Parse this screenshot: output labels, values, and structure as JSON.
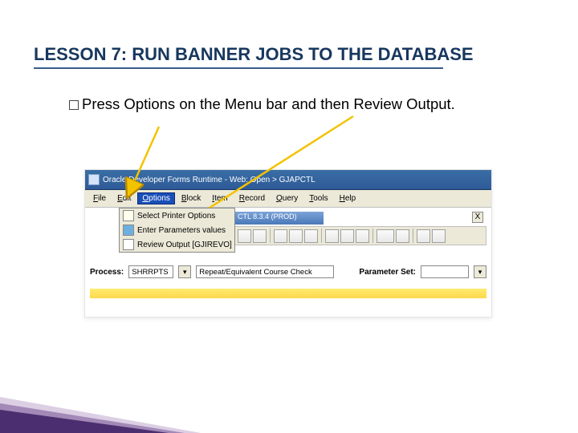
{
  "title": "LESSON 7: RUN BANNER JOBS TO THE DATABASE",
  "body": {
    "line": "Press Options on the Menu bar and then Review Output."
  },
  "screenshot": {
    "window_title": "Oracle Developer Forms Runtime - Web: Open > GJAPCTL",
    "menubar": {
      "file": "File",
      "file_ul": "F",
      "edit": "Edit",
      "edit_ul": "E",
      "options": "Options",
      "options_ul": "O",
      "block": "Block",
      "block_ul": "B",
      "item": "Item",
      "item_ul": "I",
      "record": "Record",
      "record_ul": "R",
      "query": "Query",
      "query_ul": "Q",
      "tools": "Tools",
      "tools_ul": "T",
      "help": "Help",
      "help_ul": "H"
    },
    "dropdown": {
      "opt1": "Select Printer Options",
      "opt2": "Enter Parameters values",
      "opt3": "Review Output [GJIREVO]",
      "ul1": "S",
      "ul2": "E",
      "ul3": "R"
    },
    "inner_title": "CTL 8.3.4 (PROD)",
    "close_x": "X",
    "process": {
      "label": "Process:",
      "code": "SHRRPTS",
      "desc": "Repeat/Equivalent Course Check",
      "paramset_label": "Parameter Set:",
      "paramset_value": "",
      "caret": "▾"
    }
  }
}
